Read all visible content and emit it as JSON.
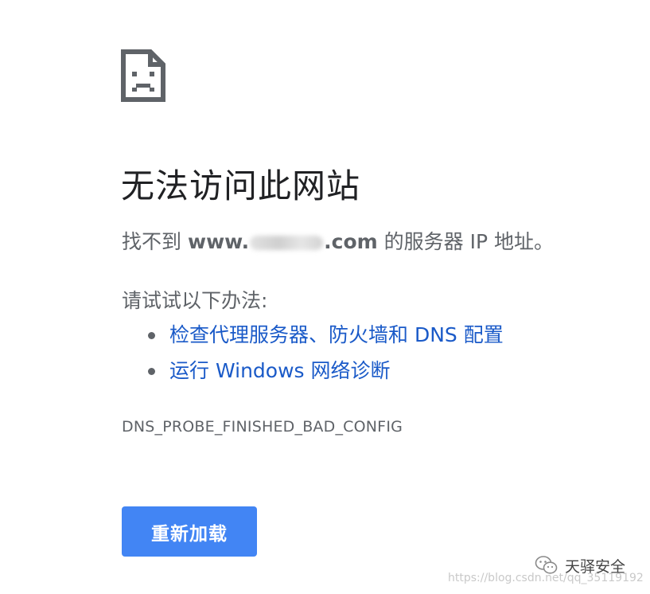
{
  "error_page": {
    "icon": "sad-document-icon",
    "title": "无法访问此网站",
    "message_prefix": "找不到",
    "domain_prefix": "www.",
    "domain_suffix": ".com",
    "message_suffix": "的服务器 IP 地址。",
    "suggestions_heading": "请试试以下办法:",
    "suggestions": [
      {
        "label": "检查代理服务器、防火墙和 DNS 配置"
      },
      {
        "label": "运行 Windows 网络诊断"
      }
    ],
    "error_code": "DNS_PROBE_FINISHED_BAD_CONFIG",
    "reload_label": "重新加载"
  },
  "watermark": {
    "icon": "wechat-icon",
    "brand": "天驿安全",
    "url": "https://blog.csdn.net/qq_35119192"
  },
  "colors": {
    "title": "#202124",
    "body_text": "#5f6368",
    "link": "#1a5ac8",
    "button_bg": "#4285f4",
    "button_text": "#ffffff"
  }
}
